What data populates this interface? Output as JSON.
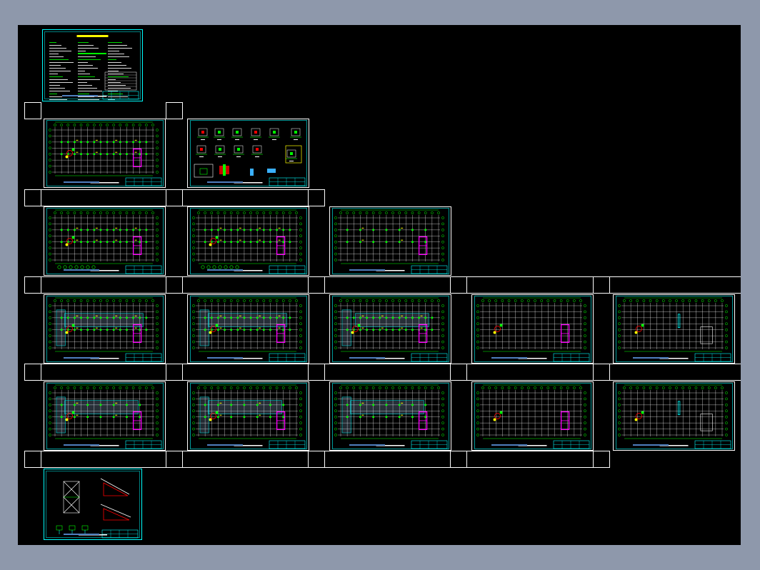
{
  "viewport": {
    "name": "cad-model-space",
    "background_color": "#000000",
    "frame_color": "#8e98ab"
  },
  "colors": {
    "grid": "#ffffff",
    "column": "#00ff00",
    "axis": "#00ffff",
    "accent": "#ff00ff",
    "annotation": "#ffff00",
    "highlight": "#ff0000",
    "hatch": "#b0d8ff",
    "title_block": "#00ffff"
  },
  "drawing_sets": {
    "cover": {
      "kind": "design-notes"
    },
    "row1": [
      "plan",
      "details"
    ],
    "row2": [
      "plan",
      "plan",
      "plan"
    ],
    "row3": [
      "plan",
      "plan",
      "plan",
      "plan",
      "plan"
    ],
    "row4": [
      "plan",
      "plan",
      "plan",
      "plan",
      "plan"
    ],
    "stairs": {
      "kind": "stair-details"
    }
  }
}
